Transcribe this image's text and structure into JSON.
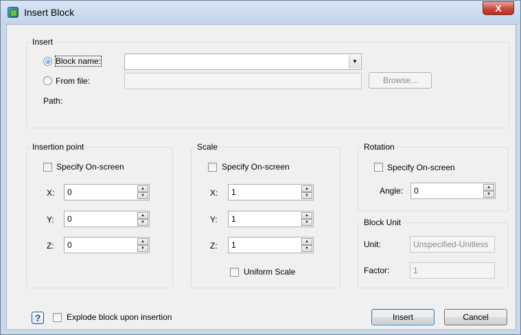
{
  "window": {
    "title": "Insert Block",
    "close_label": "X"
  },
  "insert": {
    "group_label": "Insert",
    "block_name_label": "Block name:",
    "block_name_value": "",
    "from_file_label": "From file:",
    "from_file_value": "",
    "browse_label": "Browse...",
    "path_label": "Path:"
  },
  "insertion_point": {
    "group_label": "Insertion point",
    "specify_label": "Specify On-screen",
    "x_label": "X:",
    "x_value": "0",
    "y_label": "Y:",
    "y_value": "0",
    "z_label": "Z:",
    "z_value": "0"
  },
  "scale": {
    "group_label": "Scale",
    "specify_label": "Specify On-screen",
    "x_label": "X:",
    "x_value": "1",
    "y_label": "Y:",
    "y_value": "1",
    "z_label": "Z:",
    "z_value": "1",
    "uniform_label": "Uniform Scale"
  },
  "rotation": {
    "group_label": "Rotation",
    "specify_label": "Specify On-screen",
    "angle_label": "Angle:",
    "angle_value": "0"
  },
  "block_unit": {
    "group_label": "Block Unit",
    "unit_label": "Unit:",
    "unit_value": "Unspecified-Unitless",
    "factor_label": "Factor:",
    "factor_value": "1"
  },
  "footer": {
    "help_label": "?",
    "explode_label": "Explode block upon insertion",
    "insert_label": "Insert",
    "cancel_label": "Cancel"
  },
  "icons": {
    "spin_up": "▲",
    "spin_down": "▼",
    "dropdown": "▼"
  }
}
